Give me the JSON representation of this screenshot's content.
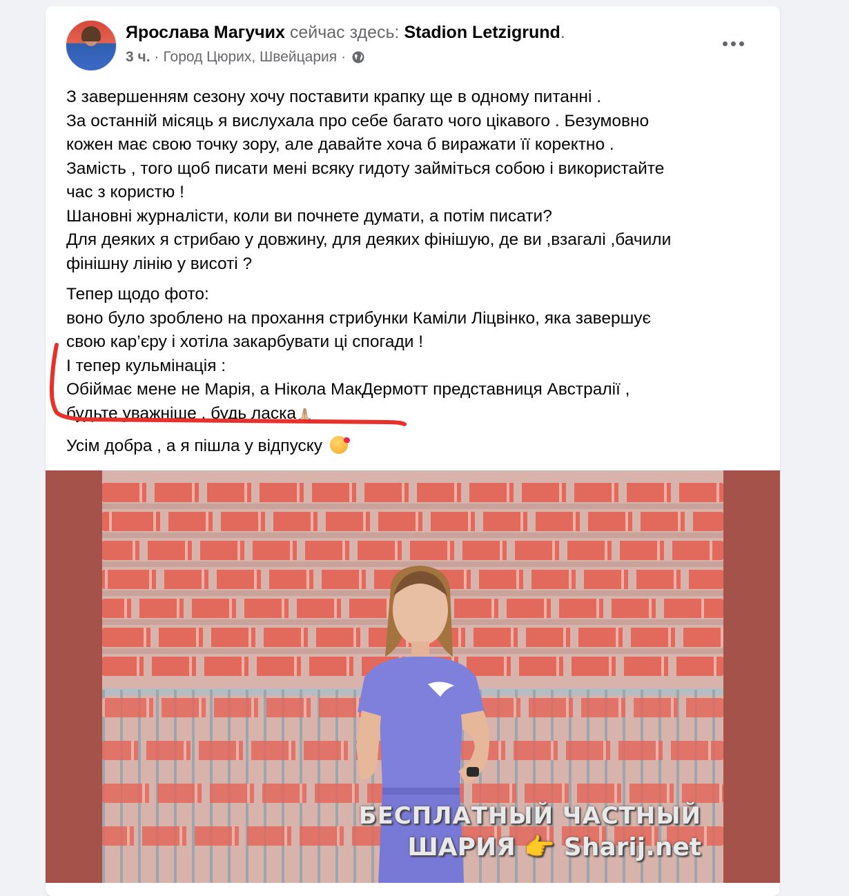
{
  "post": {
    "author": "Ярослава Магучих",
    "checkin_text": "сейчас здесь:",
    "place": "Stadion Letzigrund",
    "place_suffix": ".",
    "time_ago": "3 ч.",
    "separator": "·",
    "location": "Город Цюрих, Швейцария",
    "privacy_icon": "globe-icon",
    "more_icon": "more-horizontal-icon"
  },
  "body": {
    "lines_p1": [
      "З завершенням сезону хочу  поставити крапку  ще в одному питанні .",
      "За останній  місяць я вислухала про себе багато чого цікавого . Безумовно",
      "кожен має свою точку зору, але давайте хоча б виражати її коректно .",
      "Замість , того щоб писати мені всяку гидоту займіться собою і використайте",
      "час з користю !",
      "Шановні журналісти, коли ви почнете думати, а потім писати?",
      "Для деяких я стрибаю у довжину, для деяких фінішую, де ви ,взагалі ,бачили",
      "фінішну лінію у висоті ?"
    ],
    "lines_p2": [
      "Тепер щодо фото:",
      "воно було зроблено на прохання  стрибунки Каміли Ліцвінко, яка завершує",
      "свою кар’єру  і хотіла закарбувати ці спогади !",
      "І тепер кульмінація :",
      "Обіймає мене не Марія, а Нікола МакДермотт представниця Австралії ,",
      "будьте уважніше , будь ласка"
    ],
    "line_p3": "Усім добра , а я пішла у відпуску",
    "pray_emoji": "🙏🏼",
    "kiss_icon": "face-blowing-kiss-icon"
  },
  "watermark": {
    "line1": "БЕСПЛАТНЫЙ ЧАСТНЫЙ",
    "line2": "ШАРИЯ 👉 Sharij.net"
  },
  "colors": {
    "frame_background": "#a5524b",
    "annotation_red": "#e8312a",
    "secondary_text": "#65676b"
  }
}
